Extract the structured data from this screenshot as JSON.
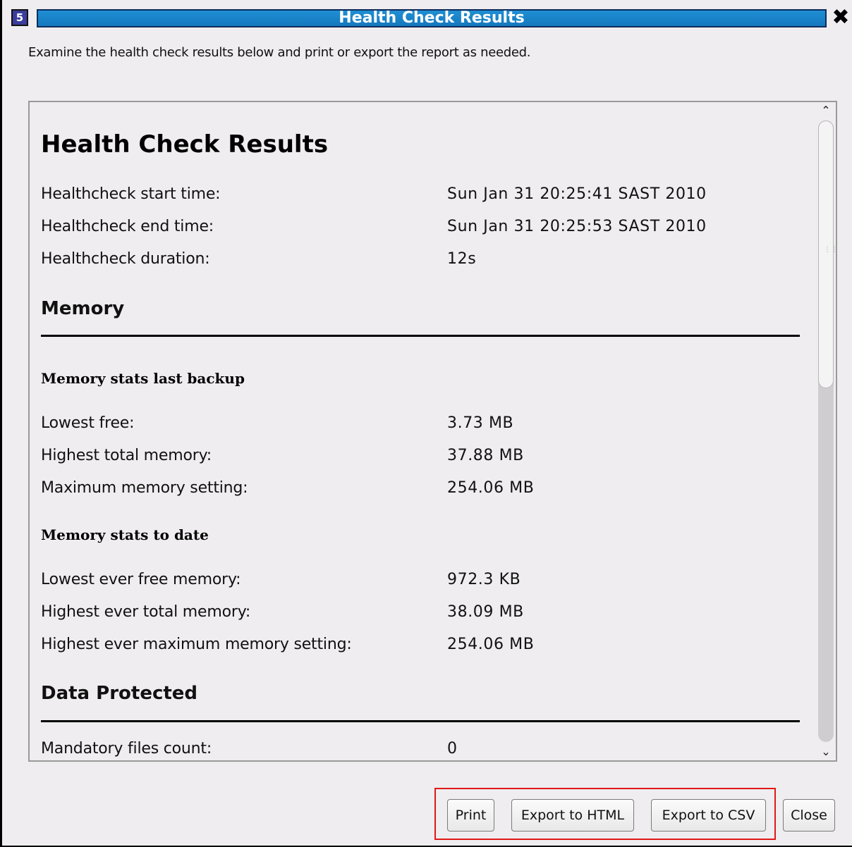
{
  "window": {
    "title": "Health Check Results",
    "app_icon_letter": "5",
    "close_glyph": "✖"
  },
  "instruction": "Examine the health check results below and print or export the report as needed.",
  "report": {
    "title": "Health Check Results",
    "summary": [
      {
        "label": "Healthcheck start time:",
        "value": "Sun Jan 31 20:25:41 SAST 2010"
      },
      {
        "label": "Healthcheck end time:",
        "value": "Sun Jan 31 20:25:53 SAST 2010"
      },
      {
        "label": "Healthcheck duration:",
        "value": "12s"
      }
    ],
    "memory": {
      "heading": "Memory",
      "last_backup": {
        "heading": "Memory stats  last backup",
        "rows": [
          {
            "label": "Lowest free:",
            "value": "3.73 MB"
          },
          {
            "label": "Highest total memory:",
            "value": "37.88 MB"
          },
          {
            "label": "Maximum memory setting:",
            "value": "254.06 MB"
          }
        ]
      },
      "to_date": {
        "heading": "Memory stats  to date",
        "rows": [
          {
            "label": "Lowest ever free memory:",
            "value": "972.3 KB"
          },
          {
            "label": "Highest ever total memory:",
            "value": "38.09 MB"
          },
          {
            "label": "Highest ever maximum memory setting:",
            "value": "254.06 MB"
          }
        ]
      }
    },
    "data_protected": {
      "heading": "Data Protected",
      "rows": [
        {
          "label": "Mandatory files count:",
          "value": "0"
        }
      ]
    }
  },
  "scrollbar": {
    "up_glyph": "⌃",
    "down_glyph": "⌄",
    "grip": "⋮⋮"
  },
  "buttons": {
    "print": "Print",
    "export_html": "Export to HTML",
    "export_csv": "Export to CSV",
    "close": "Close"
  },
  "colors": {
    "title_bar": "#1f8fd4",
    "highlight": "#e01818",
    "background": "#efedef"
  }
}
